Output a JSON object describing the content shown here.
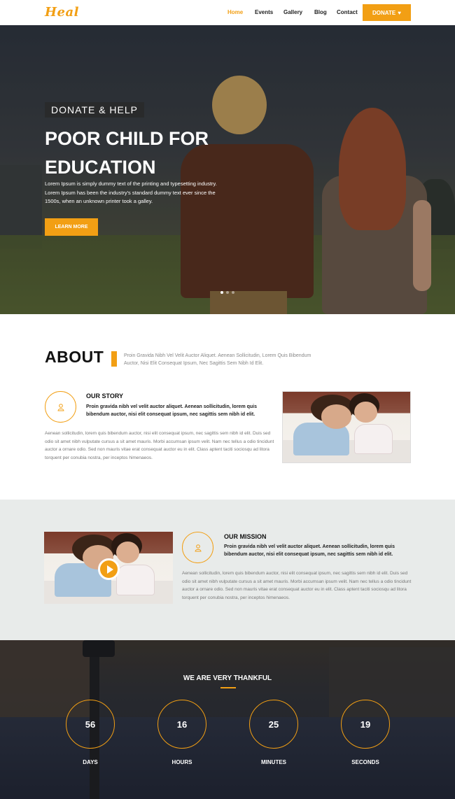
{
  "nav": {
    "logo": "Heal",
    "items": [
      "Home",
      "Events",
      "Gallery",
      "Blog",
      "Contact"
    ],
    "active_index": 0,
    "donate_label": "DONATE",
    "donate_icon": "heart-icon"
  },
  "hero": {
    "eyebrow": "DONATE  &  HELP",
    "title": "POOR CHILD FOR EDUCATION",
    "text": "Lorem Ipsum is simply dummy text of the printing and typesetting industry. Lorem Ipsum has been the industry's standard dummy text ever since the 1500s, when an unknown printer took a galley.",
    "button": "LEARN MORE",
    "slides": 3,
    "active_slide": 0
  },
  "about": {
    "title": "ABOUT",
    "description": "Proin Gravida Nibh Vel Velit Auctor Aliquet. Aenean Sollicitudin, Lorem Quis Bibendum Auctor, Nisi Elit Consequat Ipsum, Nec Sagittis Sem Nibh Id Elit.",
    "story": {
      "icon": "user-icon",
      "title": "OUR STORY",
      "lead": "Proin gravida nibh vel velit auctor aliquet. Aenean sollicitudin, lorem quis bibendum auctor, nisi elit consequat ipsum, nec sagittis sem nibh id elit.",
      "body": "Aenean sollicitudin, lorem quis bibendum auctor, nisi elit consequat ipsum, nec sagittis sem nibh id elit. Duis sed odio sit amet nibh vulputate cursus a sit amet mauris. Morbi accumsan ipsum velit. Nam nec tellus a odio tincidunt auctor a ornare odio. Sed non mauris vitae erat consequat auctor eu in elit. Class aptent taciti sociosqu ad litora torquent per conubia nostra, per inceptos himenaeos."
    }
  },
  "mission": {
    "icon": "user-icon",
    "title": "OUR MISSION",
    "lead": "Proin gravida nibh vel velit auctor aliquet. Aenean sollicitudin, lorem quis bibendum auctor, nisi elit consequat ipsum, nec sagittis sem nibh id elit.",
    "body": "Aenean sollicitudin, lorem quis bibendum auctor, nisi elit consequat ipsum, nec sagittis sem nibh id elit. Duis sed odio sit amet nibh vulputate cursus a sit amet mauris. Morbi accumsan ipsum velit. Nam nec tellus a odio tincidunt auctor a ornare odio. Sed non mauris vitae erat consequat auctor eu in elit. Class aptent taciti sociosqu ad litora torquent per conubia nostra, per inceptos himenaeos.",
    "video_icon": "play-icon"
  },
  "countdown": {
    "title": "WE ARE VERY THANKFUL",
    "items": [
      {
        "value": "56",
        "label": "DAYS"
      },
      {
        "value": "16",
        "label": "HOURS"
      },
      {
        "value": "25",
        "label": "MINUTES"
      },
      {
        "value": "19",
        "label": "SECONDS"
      }
    ]
  },
  "colors": {
    "accent": "#f29f14",
    "mission_band": "#e8ebea"
  }
}
